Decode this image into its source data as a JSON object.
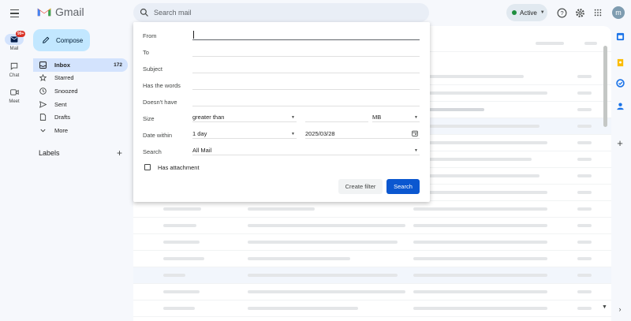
{
  "app": {
    "name": "Gmail"
  },
  "search": {
    "placeholder": "Search mail"
  },
  "status": {
    "label": "Active"
  },
  "account": {
    "initial": "m"
  },
  "rail": {
    "mail": {
      "label": "Mail",
      "badge": "99+"
    },
    "chat": {
      "label": "Chat"
    },
    "meet": {
      "label": "Meet"
    }
  },
  "sidebar": {
    "compose_label": "Compose",
    "items": [
      {
        "label": "Inbox",
        "count": "172",
        "icon": "inbox-icon"
      },
      {
        "label": "Starred",
        "icon": "star-icon"
      },
      {
        "label": "Snoozed",
        "icon": "clock-icon"
      },
      {
        "label": "Sent",
        "icon": "send-icon"
      },
      {
        "label": "Drafts",
        "icon": "draft-icon"
      },
      {
        "label": "More",
        "icon": "chevron-down-icon"
      }
    ],
    "labels_heading": "Labels"
  },
  "advanced_search": {
    "from_label": "From",
    "to_label": "To",
    "subject_label": "Subject",
    "has_words_label": "Has the words",
    "doesnt_have_label": "Doesn't have",
    "size_label": "Size",
    "size_operator": "greater than",
    "size_unit": "MB",
    "date_within_label": "Date within",
    "date_range": "1 day",
    "date_value": "2025/03/28",
    "search_in_label": "Search",
    "search_in_value": "All Mail",
    "has_attachment_label": "Has attachment",
    "create_filter_label": "Create filter",
    "search_button_label": "Search"
  },
  "colors": {
    "accent": "#0b57d0",
    "compose_bg": "#c2e7ff",
    "active_nav": "#d3e3fd",
    "status_green": "#1e8e3e",
    "badge_red": "#d93025"
  }
}
